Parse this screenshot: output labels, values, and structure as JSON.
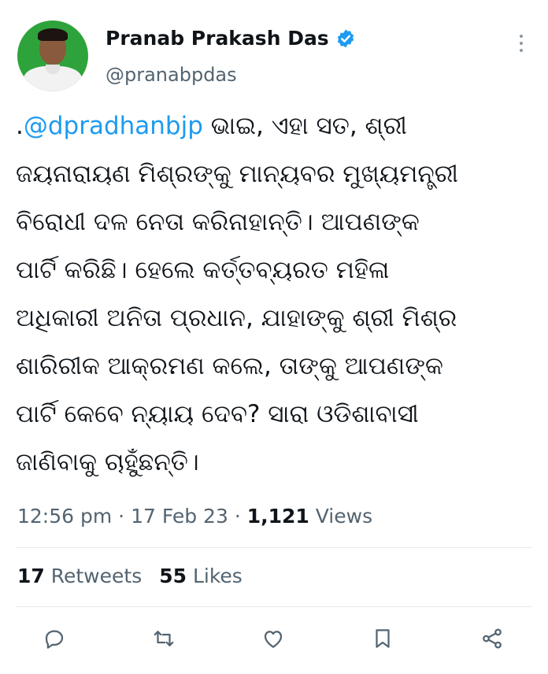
{
  "author": {
    "name": "Pranab Prakash Das",
    "handle": "@pranabpdas",
    "verified_icon": "verified-badge-icon",
    "avatar_bg": "#2fa33b"
  },
  "tweet": {
    "prefix": ".",
    "mention": "@dpradhanbjp",
    "body": " ଭାଇ, ଏହା ସତ, ଶ୍ରୀ\nଜୟନାରାୟଣ ମିଶ୍ରଙ୍କୁ ମାନ୍ୟବର ମୁଖ୍ୟମନ୍ତ୍ରୀ\nବିରୋଧୀ ଦଳ ନେତା କରିନାହାନ୍ତି। ଆପଣଙ୍କ\nପାର୍ଟି କରିଛି। ହେଲେ କର୍ତ୍ତବ୍ୟରତ ମହିଳା\nଅଧିକାରୀ ଅନିତା ପ୍ରଧାନ, ଯାହାଙ୍କୁ ଶ୍ରୀ ମିଶ୍ର\nଶାରିରୀକ ଆକ୍ରମଣ କଲେ, ତାଙ୍କୁ ଆପଣଙ୍କ\nପାର୍ଟି କେବେ ନ୍ୟାୟ ଦେବ? ସାରା ଓଡିଶାବାସୀ\nଜାଣିବାକୁ ଚାହୁଁଛନ୍ତି।"
  },
  "meta": {
    "time": "12:56 pm",
    "date": "17 Feb 23",
    "views_count": "1,121",
    "views_label": "Views",
    "separator": "·"
  },
  "stats": {
    "retweets_count": "17",
    "retweets_label": "Retweets",
    "likes_count": "55",
    "likes_label": "Likes"
  },
  "actions": [
    "reply-icon",
    "retweet-icon",
    "like-icon",
    "bookmark-icon",
    "share-icon"
  ],
  "colors": {
    "text": "#0f1419",
    "secondary": "#536471",
    "accent": "#1d9bf0",
    "divider": "#e6e9ec"
  }
}
